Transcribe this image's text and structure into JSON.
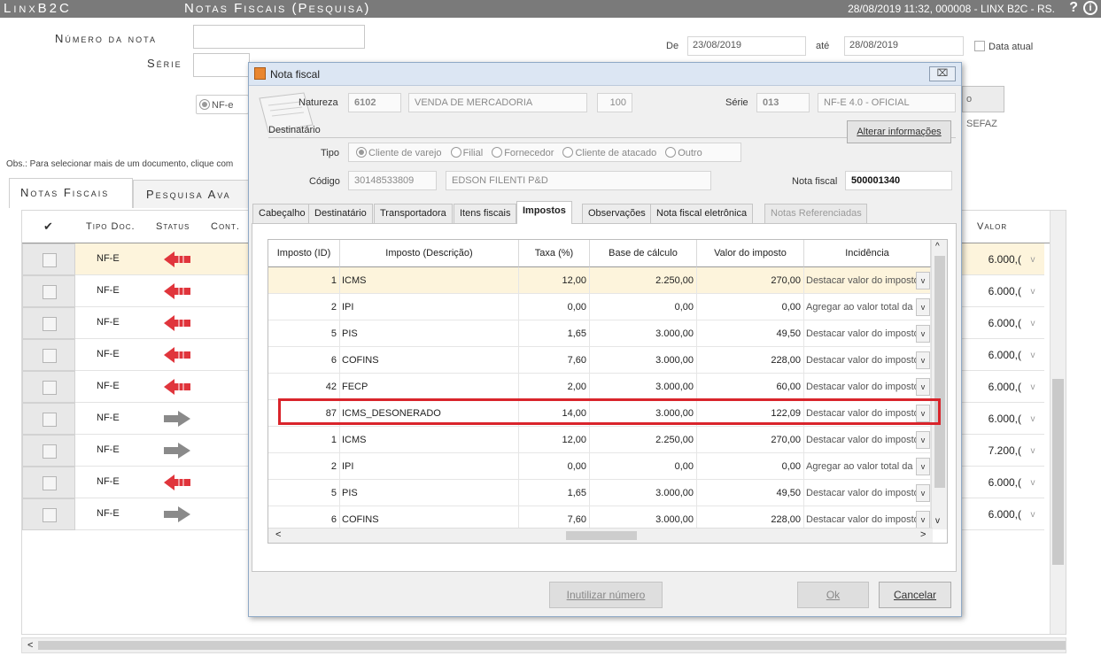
{
  "topbar": {
    "app_name": "LinxB2C",
    "screen_title": "Notas Fiscais (Pesquisa)",
    "session_info": "28/08/2019 11:32, 000008 - LINX B2C - RS.",
    "help_icon": "?",
    "info_icon": "i"
  },
  "search": {
    "numero_label": "Número da nota",
    "serie_label": "Série",
    "de_label": "De",
    "de_value": "23/08/2019",
    "ate_label": "até",
    "ate_value": "28/08/2019",
    "data_atual_label": "Data atual",
    "nfe_label": "NF-e",
    "sefaz_label": "o SEFAZ",
    "obs_text": "Obs.: Para selecionar mais de um documento, clique com"
  },
  "main_tabs": {
    "notas_fiscais": "Notas Fiscais",
    "pesquisa_avancada": "Pesquisa Ava"
  },
  "bg_grid": {
    "headers": {
      "check": "✔",
      "tipo_doc": "Tipo Doc.",
      "status": "Status",
      "cont": "Cont.",
      "valor": "Valor"
    },
    "rows": [
      {
        "tipo": "NF-E",
        "status": "cancel",
        "valor": "6.000,("
      },
      {
        "tipo": "NF-E",
        "status": "cancel",
        "valor": "6.000,("
      },
      {
        "tipo": "NF-E",
        "status": "cancel",
        "valor": "6.000,("
      },
      {
        "tipo": "NF-E",
        "status": "cancel",
        "valor": "6.000,("
      },
      {
        "tipo": "NF-E",
        "status": "cancel",
        "valor": "6.000,("
      },
      {
        "tipo": "NF-E",
        "status": "ok",
        "valor": "6.000,("
      },
      {
        "tipo": "NF-E",
        "status": "ok",
        "valor": "7.200,("
      },
      {
        "tipo": "NF-E",
        "status": "cancel",
        "valor": "6.000,("
      },
      {
        "tipo": "NF-E",
        "status": "ok",
        "valor": "6.000,("
      }
    ]
  },
  "modal": {
    "title": "Nota fiscal",
    "close_label": "⌧",
    "natureza_label": "Natureza",
    "natureza_code": "6102",
    "natureza_desc": "VENDA DE MERCADORIA",
    "natureza_num": "100",
    "serie_label": "Série",
    "serie_code": "013",
    "serie_desc": "NF-E 4.0 - OFICIAL",
    "destinatario_label": "Destinatário",
    "alterar_label": "Alterar informações",
    "tipo_label": "Tipo",
    "tipo_options": [
      "Cliente de varejo",
      "Filial",
      "Fornecedor",
      "Cliente de atacado",
      "Outro"
    ],
    "codigo_label": "Código",
    "codigo_value": "30148533809",
    "cliente_nome": "EDSON FILENTI P&D",
    "nota_fiscal_label": "Nota fiscal",
    "nota_fiscal_value": "500001340",
    "tabs": [
      "Cabeçalho",
      "Destinatário",
      "Transportadora",
      "Itens fiscais",
      "Impostos",
      "Observações",
      "Nota fiscal eletrônica",
      "Notas Referenciadas"
    ],
    "inutilizar_label": "Inutilizar número",
    "ok_label": "Ok",
    "cancelar_label": "Cancelar"
  },
  "tax_table": {
    "columns": [
      "Imposto (ID)",
      "Imposto (Descrição)",
      "Taxa (%)",
      "Base de cálculo",
      "Valor do imposto",
      "Incidência"
    ],
    "rows": [
      {
        "id": "1",
        "desc": "ICMS",
        "taxa": "12,00",
        "base": "2.250,00",
        "valor": "270,00",
        "inc": "Destacar valor do imposto"
      },
      {
        "id": "2",
        "desc": "IPI",
        "taxa": "0,00",
        "base": "0,00",
        "valor": "0,00",
        "inc": "Agregar ao valor total da"
      },
      {
        "id": "5",
        "desc": "PIS",
        "taxa": "1,65",
        "base": "3.000,00",
        "valor": "49,50",
        "inc": "Destacar valor do imposto"
      },
      {
        "id": "6",
        "desc": "COFINS",
        "taxa": "7,60",
        "base": "3.000,00",
        "valor": "228,00",
        "inc": "Destacar valor do imposto"
      },
      {
        "id": "42",
        "desc": "FECP",
        "taxa": "2,00",
        "base": "3.000,00",
        "valor": "60,00",
        "inc": "Destacar valor do imposto"
      },
      {
        "id": "87",
        "desc": "ICMS_DESONERADO",
        "taxa": "14,00",
        "base": "3.000,00",
        "valor": "122,09",
        "inc": "Destacar valor do imposto"
      },
      {
        "id": "1",
        "desc": "ICMS",
        "taxa": "12,00",
        "base": "2.250,00",
        "valor": "270,00",
        "inc": "Destacar valor do imposto"
      },
      {
        "id": "2",
        "desc": "IPI",
        "taxa": "0,00",
        "base": "0,00",
        "valor": "0,00",
        "inc": "Agregar ao valor total da"
      },
      {
        "id": "5",
        "desc": "PIS",
        "taxa": "1,65",
        "base": "3.000,00",
        "valor": "49,50",
        "inc": "Destacar valor do imposto"
      },
      {
        "id": "6",
        "desc": "COFINS",
        "taxa": "7,60",
        "base": "3.000,00",
        "valor": "228,00",
        "inc": "Destacar valor do imposto"
      }
    ]
  },
  "colors": {
    "topbar": "#7a7a7a",
    "highlight": "#d9242b",
    "cancel_status": "#e0353c",
    "ok_status": "#8a8a8a"
  }
}
